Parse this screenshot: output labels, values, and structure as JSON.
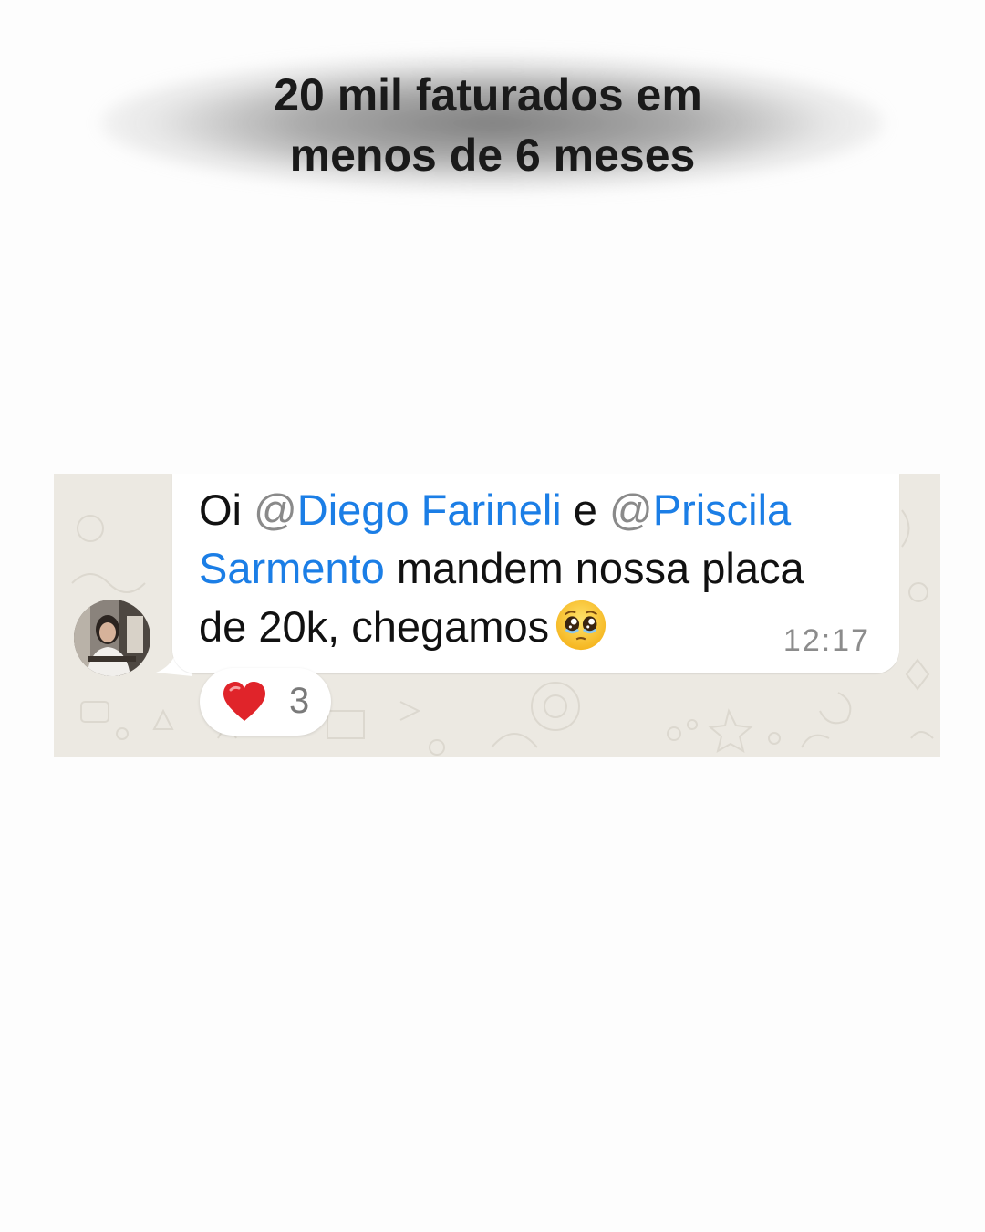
{
  "headline": {
    "line1": "20 mil faturados em",
    "line2": "menos de 6 meses"
  },
  "message": {
    "part1": "Oi ",
    "mention1_at": "@",
    "mention1_name": "Diego Farineli",
    "part2": " e ",
    "mention2_at": "@",
    "mention2_name": "Priscila Sarmento",
    "part3": " mandem nossa placa de 20k, chegamos",
    "emoji": "pleading-face-icon",
    "time": "12:17"
  },
  "reaction": {
    "icon": "heart-icon",
    "count": "3"
  },
  "colors": {
    "mention": "#1b7ee6",
    "chat_background": "#ece9e2",
    "bubble": "#ffffff",
    "heart": "#e0242a"
  }
}
